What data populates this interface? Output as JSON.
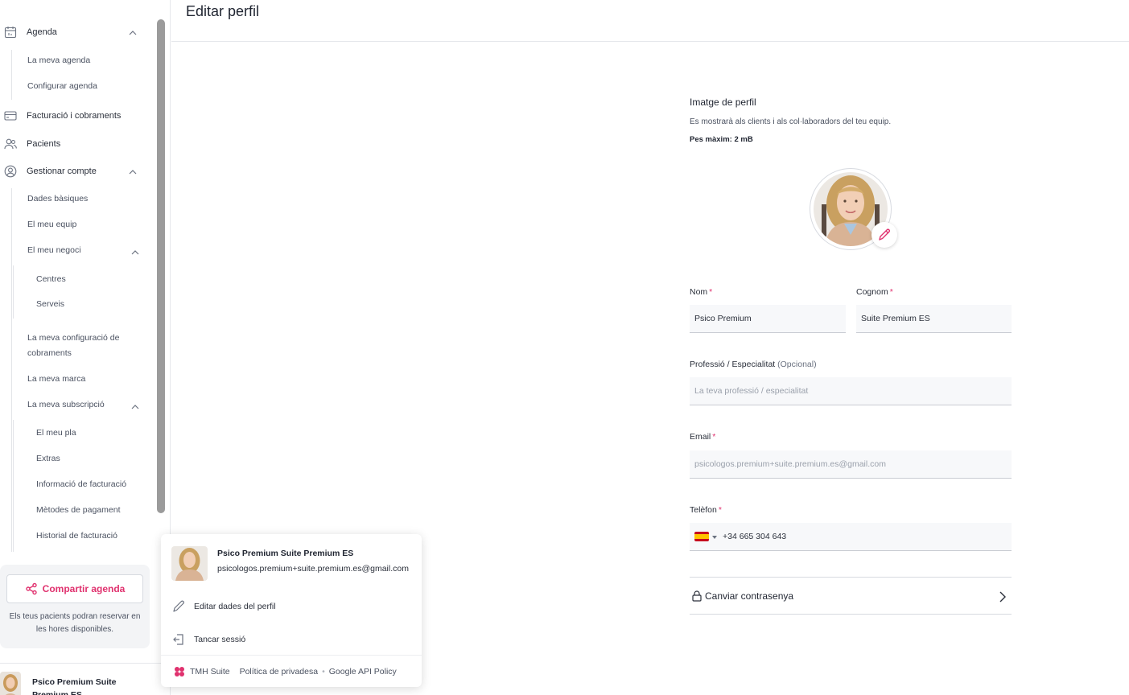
{
  "header": {
    "title": "Editar perfil"
  },
  "sidebar": {
    "agenda": {
      "label": "Agenda",
      "items": [
        "La meva agenda",
        "Configurar agenda"
      ]
    },
    "billing": {
      "label": "Facturació i cobraments"
    },
    "patients": {
      "label": "Pacients"
    },
    "account": {
      "label": "Gestionar compte",
      "items": {
        "basic": "Dades bàsiques",
        "team": "El meu equip",
        "business": {
          "label": "El meu negoci",
          "items": [
            "Centres",
            "Serveis"
          ]
        },
        "payments_config": "La meva configuració de cobraments",
        "brand": "La meva marca",
        "subscription": {
          "label": "La meva subscripció",
          "items": [
            "El meu pla",
            "Extras",
            "Informació de facturació",
            "Mètodes de pagament",
            "Historial de facturació"
          ]
        }
      }
    },
    "share": {
      "button_label": "Compartir agenda",
      "text": "Els teus pacients podran reservar en les hores disponibles."
    },
    "user_footer_name": "Psico Premium Suite Premium ES"
  },
  "profile": {
    "image_title": "Imatge de perfil",
    "image_desc": "Es mostrarà als clients i als col·laboradors del teu equip.",
    "image_max": "Pes màxim: 2 mB",
    "first_name": {
      "label": "Nom",
      "value": "Psico Premium"
    },
    "last_name": {
      "label": "Cognom",
      "value": "Suite Premium ES"
    },
    "profession": {
      "label": "Professió / Especialitat",
      "optional": "(Opcional)",
      "placeholder": "La teva professió / especialitat"
    },
    "email": {
      "label": "Email",
      "value": "psicologos.premium+suite.premium.es@gmail.com"
    },
    "phone": {
      "label": "Telèfon",
      "value": "+34 665 304 643"
    },
    "change_password": "Canviar contrasenya"
  },
  "popup": {
    "name": "Psico Premium Suite Premium ES",
    "email": "psicologos.premium+suite.premium.es@gmail.com",
    "edit_label": "Editar dades del perfil",
    "logout_label": "Tancar sessió",
    "footer": {
      "brand": "TMH Suite",
      "privacy": "Política de privadesa",
      "api": "Google API Policy"
    }
  },
  "colors": {
    "accent": "#e0316e",
    "text": "#2a2f3a",
    "border": "#d7dae0"
  }
}
